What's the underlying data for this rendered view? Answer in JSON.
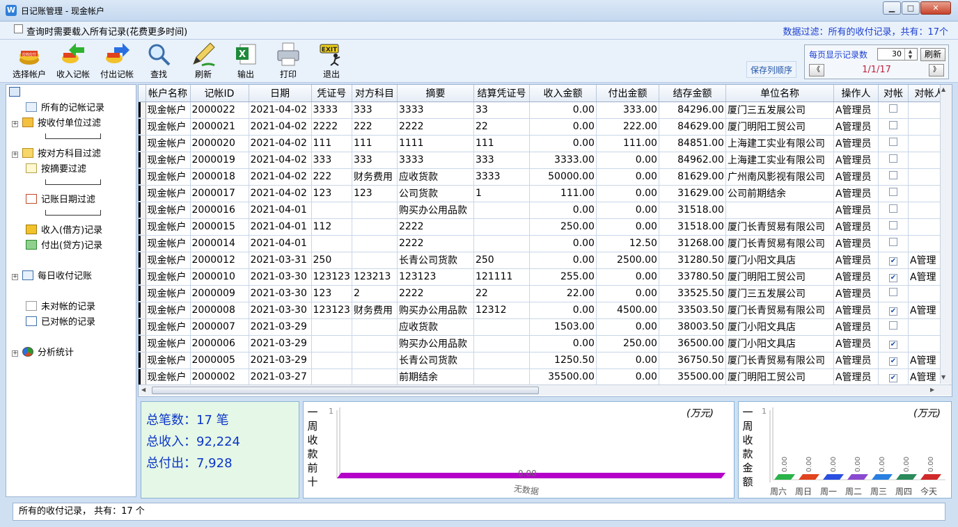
{
  "window": {
    "title": "日记账管理 - 现金帐户",
    "app_icon": "W",
    "min": "▁",
    "max": "□",
    "close": "✕"
  },
  "options": {
    "load_all_label": "查询时需要载入所有记录(花费更多时间)",
    "load_all_checked": false,
    "filter_status": "数据过滤：所有的收付记录，共有：17个"
  },
  "toolbar": {
    "items": [
      {
        "label": "选择帐户",
        "icon": "account-coins-icon"
      },
      {
        "label": "收入记帐",
        "icon": "income-arrow-icon"
      },
      {
        "label": "付出记帐",
        "icon": "payment-arrow-icon"
      },
      {
        "label": "查找",
        "icon": "magnifier-icon"
      },
      {
        "label": "刷新",
        "icon": "pen-refresh-icon"
      },
      {
        "label": "输出",
        "icon": "excel-export-icon"
      },
      {
        "label": "打印",
        "icon": "printer-icon"
      },
      {
        "label": "退出",
        "icon": "exit-icon"
      }
    ],
    "save_order": "保存列顺序"
  },
  "pager": {
    "per_page_label": "每页显示记录数",
    "per_page_value": "30",
    "refresh": "刷新",
    "prev": "《",
    "next": "》",
    "indicator": "1/1/17"
  },
  "tree": {
    "items": [
      {
        "label": "所有的记帐记录",
        "icon": "table-icon",
        "expander": ""
      },
      {
        "label": "按收付单位过滤",
        "icon": "home-icon",
        "expander": "+"
      },
      {
        "label": "按对方科目过滤",
        "icon": "folder-icon",
        "expander": "+"
      },
      {
        "label": "按摘要过滤",
        "icon": "note-icon",
        "expander": ""
      },
      {
        "label": "记账日期过滤",
        "icon": "calendar-icon",
        "expander": ""
      },
      {
        "label": "收入(借方)记录",
        "icon": "income-icon",
        "expander": ""
      },
      {
        "label": "付出(贷方)记录",
        "icon": "payment-icon",
        "expander": ""
      },
      {
        "label": "每日收付记账",
        "icon": "daily-icon",
        "expander": "+"
      },
      {
        "label": "未对帐的记录",
        "icon": "document-icon",
        "expander": ""
      },
      {
        "label": "已对帐的记录",
        "icon": "report-icon",
        "expander": ""
      },
      {
        "label": "分析统计",
        "icon": "pie-icon",
        "expander": "+"
      }
    ]
  },
  "grid": {
    "columns": [
      "帐户名称",
      "记帐ID",
      "日期",
      "凭证号",
      "对方科目",
      "摘要",
      "结算凭证号",
      "收入金额",
      "付出金额",
      "结存金额",
      "单位名称",
      "操作人",
      "对帐",
      "对帐人"
    ],
    "rows": [
      [
        "现金帐户",
        "2000022",
        "2021-04-02",
        "3333",
        "333",
        "3333",
        "33",
        "0.00",
        "333.00",
        "84296.00",
        "厦门三五发展公司",
        "A管理员",
        "0",
        ""
      ],
      [
        "现金帐户",
        "2000021",
        "2021-04-02",
        "2222",
        "222",
        "2222",
        "22",
        "0.00",
        "222.00",
        "84629.00",
        "厦门明阳工贸公司",
        "A管理员",
        "0",
        ""
      ],
      [
        "现金帐户",
        "2000020",
        "2021-04-02",
        "111",
        "111",
        "1111",
        "111",
        "0.00",
        "111.00",
        "84851.00",
        "上海建工实业有限公司",
        "A管理员",
        "0",
        ""
      ],
      [
        "现金帐户",
        "2000019",
        "2021-04-02",
        "333",
        "333",
        "3333",
        "333",
        "3333.00",
        "0.00",
        "84962.00",
        "上海建工实业有限公司",
        "A管理员",
        "0",
        ""
      ],
      [
        "现金帐户",
        "2000018",
        "2021-04-02",
        "222",
        "财务费用",
        "应收货款",
        "3333",
        "50000.00",
        "0.00",
        "81629.00",
        "广州南风影视有限公司",
        "A管理员",
        "0",
        ""
      ],
      [
        "现金帐户",
        "2000017",
        "2021-04-02",
        "123",
        "123",
        "公司货款",
        "1",
        "111.00",
        "0.00",
        "31629.00",
        "公司前期结余",
        "A管理员",
        "0",
        ""
      ],
      [
        "现金帐户",
        "2000016",
        "2021-04-01",
        "",
        "",
        "购买办公用品款",
        "",
        "0.00",
        "0.00",
        "31518.00",
        "",
        "A管理员",
        "0",
        ""
      ],
      [
        "现金帐户",
        "2000015",
        "2021-04-01",
        "112",
        "",
        "2222",
        "",
        "250.00",
        "0.00",
        "31518.00",
        "厦门长青贸易有限公司",
        "A管理员",
        "0",
        ""
      ],
      [
        "现金帐户",
        "2000014",
        "2021-04-01",
        "",
        "",
        "2222",
        "",
        "0.00",
        "12.50",
        "31268.00",
        "厦门长青贸易有限公司",
        "A管理员",
        "0",
        ""
      ],
      [
        "现金帐户",
        "2000012",
        "2021-03-31",
        "250",
        "",
        "长青公司货款",
        "250",
        "0.00",
        "2500.00",
        "31280.50",
        "厦门小阳文具店",
        "A管理员",
        "1",
        "A管理"
      ],
      [
        "现金帐户",
        "2000010",
        "2021-03-30",
        "123123",
        "123213",
        "123123",
        "121111",
        "255.00",
        "0.00",
        "33780.50",
        "厦门明阳工贸公司",
        "A管理员",
        "1",
        "A管理"
      ],
      [
        "现金帐户",
        "2000009",
        "2021-03-30",
        "123",
        "2",
        "2222",
        "22",
        "22.00",
        "0.00",
        "33525.50",
        "厦门三五发展公司",
        "A管理员",
        "0",
        ""
      ],
      [
        "现金帐户",
        "2000008",
        "2021-03-30",
        "123123",
        "财务费用",
        "购买办公用品款",
        "12312",
        "0.00",
        "4500.00",
        "33503.50",
        "厦门长青贸易有限公司",
        "A管理员",
        "1",
        "A管理"
      ],
      [
        "现金帐户",
        "2000007",
        "2021-03-29",
        "",
        "",
        "应收货款",
        "",
        "1503.00",
        "0.00",
        "38003.50",
        "厦门小阳文具店",
        "A管理员",
        "0",
        ""
      ],
      [
        "现金帐户",
        "2000006",
        "2021-03-29",
        "",
        "",
        "购买办公用品款",
        "",
        "0.00",
        "250.00",
        "36500.00",
        "厦门小阳文具店",
        "A管理员",
        "1",
        ""
      ],
      [
        "现金帐户",
        "2000005",
        "2021-03-29",
        "",
        "",
        "长青公司货款",
        "",
        "1250.50",
        "0.00",
        "36750.50",
        "厦门长青贸易有限公司",
        "A管理员",
        "1",
        "A管理"
      ],
      [
        "现金帐户",
        "2000002",
        "2021-03-27",
        "",
        "",
        "前期结余",
        "",
        "35500.00",
        "0.00",
        "35500.00",
        "厦门明阳工贸公司",
        "A管理员",
        "1",
        "A管理"
      ]
    ]
  },
  "summary": {
    "count": "总笔数：17 笔",
    "income": "总收入：92,224",
    "payment": "总付出：7,928"
  },
  "chart_left": {
    "title": "一周收款前十",
    "unit": "(万元)",
    "y_tick": "1",
    "bar_value": "0.00",
    "no_data": "无数据",
    "bar_color": "#b400c8"
  },
  "chart_right": {
    "title": "一周收款金额",
    "unit": "(万元)",
    "y_tick": "1",
    "days": [
      "周六",
      "周日",
      "周一",
      "周二",
      "周三",
      "周四",
      "今天"
    ],
    "values": [
      "0.00",
      "0.00",
      "0.00",
      "0.00",
      "0.00",
      "0.00",
      "0.00"
    ]
  },
  "status": {
    "text": "所有的收付记录，  共有：17  个"
  }
}
